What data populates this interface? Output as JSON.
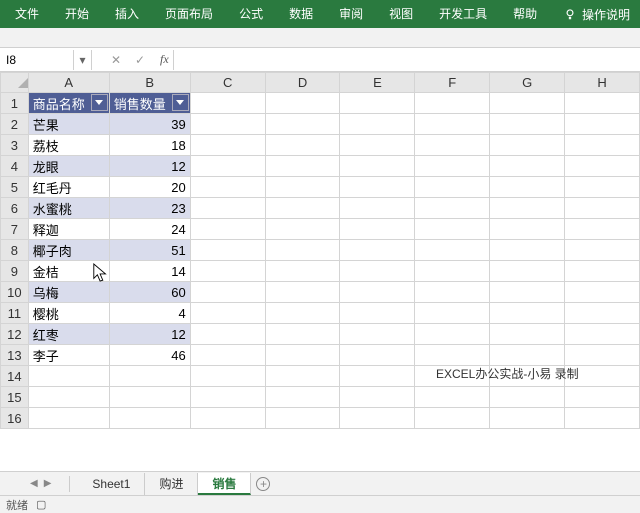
{
  "ribbon": {
    "tabs": [
      "文件",
      "开始",
      "插入",
      "页面布局",
      "公式",
      "数据",
      "审阅",
      "视图",
      "开发工具",
      "帮助"
    ],
    "tip": "操作说明"
  },
  "formula_bar": {
    "name_box": "I8",
    "fx_label": "fx"
  },
  "columns": [
    "A",
    "B",
    "C",
    "D",
    "E",
    "F",
    "G",
    "H"
  ],
  "row_numbers": [
    1,
    2,
    3,
    4,
    5,
    6,
    7,
    8,
    9,
    10,
    11,
    12,
    13,
    14,
    15,
    16
  ],
  "table": {
    "headers": [
      "商品名称",
      "销售数量"
    ],
    "rows": [
      {
        "name": "芒果",
        "qty": 39
      },
      {
        "name": "荔枝",
        "qty": 18
      },
      {
        "name": "龙眼",
        "qty": 12
      },
      {
        "name": "红毛丹",
        "qty": 20
      },
      {
        "name": "水蜜桃",
        "qty": 23
      },
      {
        "name": "释迦",
        "qty": 24
      },
      {
        "name": "椰子肉",
        "qty": 51
      },
      {
        "name": "金桔",
        "qty": 14
      },
      {
        "name": "乌梅",
        "qty": 60
      },
      {
        "name": "樱桃",
        "qty": 4
      },
      {
        "name": "红枣",
        "qty": 12
      },
      {
        "name": "李子",
        "qty": 46
      }
    ]
  },
  "overlay": {
    "credit": "EXCEL办公实战-小易 录制"
  },
  "sheet_tabs": {
    "tabs": [
      "Sheet1",
      "购进",
      "销售"
    ],
    "active_index": 2,
    "new_label": "+"
  },
  "status": {
    "mode": "就绪",
    "macro": "⏵"
  }
}
